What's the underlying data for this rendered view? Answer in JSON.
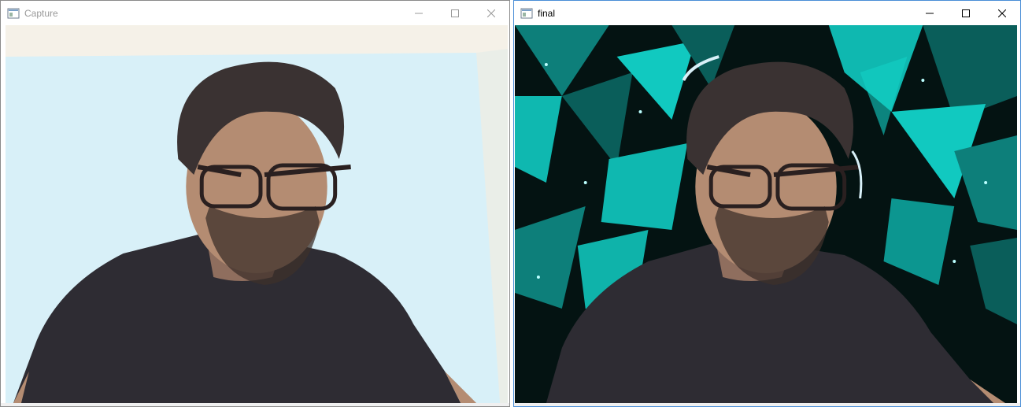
{
  "windows": [
    {
      "title": "Capture",
      "controls": {
        "minimize": "minimize-icon",
        "maximize": "maximize-icon",
        "close": "close-icon"
      },
      "content": "webcam-frame-original"
    },
    {
      "title": "final",
      "controls": {
        "minimize": "minimize-icon",
        "maximize": "maximize-icon",
        "close": "close-icon"
      },
      "content": "webcam-frame-background-replaced"
    }
  ],
  "colors": {
    "wall": "#d8f0f8",
    "ceiling": "#f5f1e8",
    "shirt": "#2e2c33",
    "skin": "#b48c72",
    "hair": "#3a3232",
    "teal": "#0fb8b0",
    "dark_bg": "#041312",
    "active_border": "#4a8ed6"
  }
}
